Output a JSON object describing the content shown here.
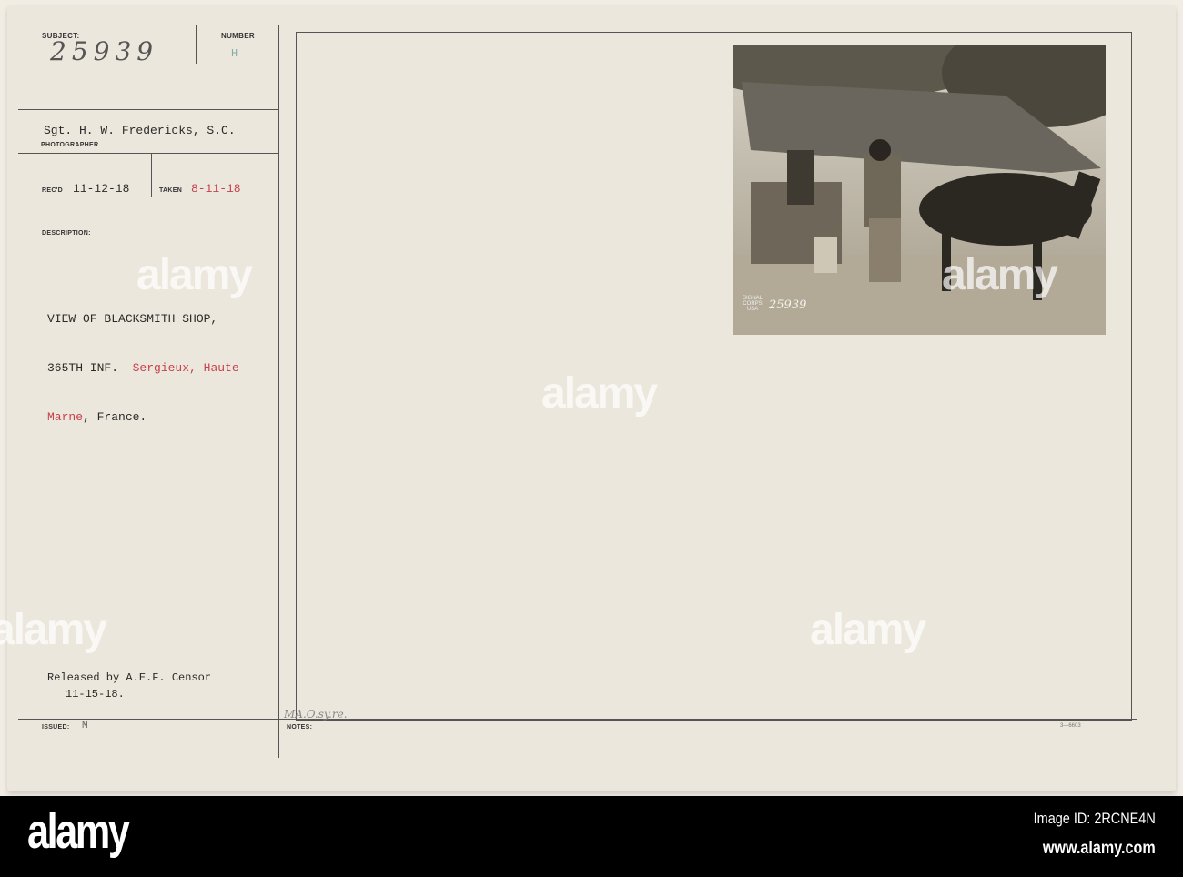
{
  "card": {
    "subject_label": "SUBJECT:",
    "subject_value": "25939",
    "number_label": "NUMBER",
    "number_value": "H",
    "photographer_name": "Sgt. H. W. Fredericks, S.C.",
    "photographer_label": "PHOTOGRAPHER",
    "recd_label": "REC'D",
    "recd_value": "11-12-18",
    "taken_label": "TAKEN",
    "taken_value": "8-11-18",
    "description_label": "DESCRIPTION:",
    "description_line1": "VIEW OF BLACKSMITH SHOP,",
    "description_line2a": "365TH INF.",
    "description_line2b": "Sergieux, Haute",
    "description_line3a": "Marne",
    "description_line3b": ", France.",
    "released_line1": "Released by A.E.F. Censor",
    "released_line2": "11-15-18.",
    "issued_label": "ISSUED:",
    "issued_value": "M",
    "notes_label": "NOTES:",
    "notes_handwriting": "MA.O.sy.re.",
    "form_number": "3—6603"
  },
  "photo": {
    "stamp_text": "SIGNAL CORPS USA",
    "photo_number": "25939"
  },
  "footer": {
    "brand": "alamy",
    "image_id": "Image ID: 2RCNE4N",
    "url": "www.alamy.com"
  }
}
